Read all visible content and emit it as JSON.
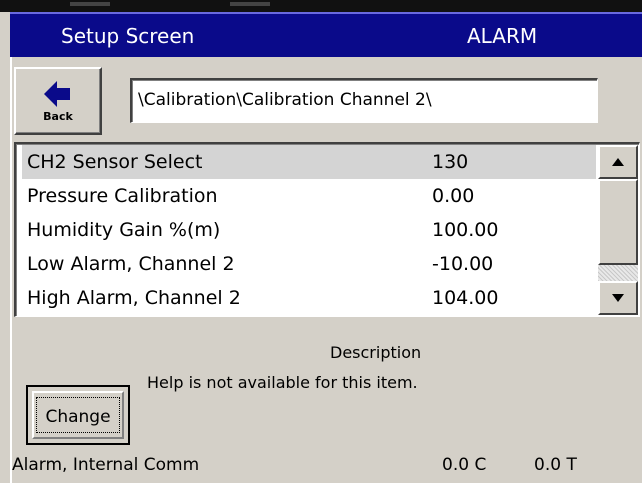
{
  "header": {
    "title": "Setup Screen",
    "mode": "ALARM"
  },
  "nav": {
    "back_label": "Back",
    "back_icon": "left-arrow-icon",
    "path": "\\Calibration\\Calibration Channel 2\\"
  },
  "settings": {
    "rows": [
      {
        "name": "CH2 Sensor Select",
        "value": "130"
      },
      {
        "name": "Pressure Calibration",
        "value": "0.00"
      },
      {
        "name": "Humidity Gain %(m)",
        "value": "100.00"
      },
      {
        "name": "Low Alarm, Channel 2",
        "value": "-10.00"
      },
      {
        "name": "High Alarm, Channel 2",
        "value": "104.00"
      }
    ],
    "selected_index": 0
  },
  "description": {
    "title": "Description",
    "text": "Help is not available for this item."
  },
  "actions": {
    "change_label": "Change"
  },
  "status": {
    "message": "Alarm, Internal Comm",
    "value1": "0.0 C",
    "value2": "0.0 T"
  },
  "colors": {
    "titlebar": "#0a0a8a",
    "panel": "#d4d0c8",
    "selection": "#d4d4d4"
  }
}
